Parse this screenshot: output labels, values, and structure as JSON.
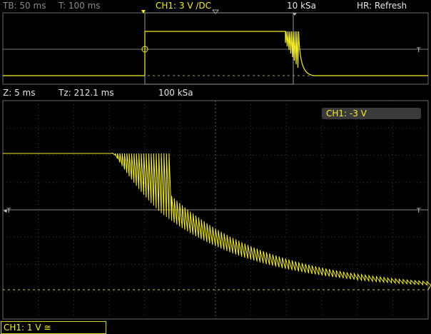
{
  "top_bar": {
    "timebase": "TB: 50 ms",
    "time": "T: 100 ms",
    "channel": "CH1: 3 V ∕DC",
    "sample_rate": "10 kSa",
    "mode": "HR: Refresh"
  },
  "zoom_bar": {
    "zoom": "Z: 5 ms",
    "tz": "Tz: 212.1 ms",
    "sample_rate": "100 kSa"
  },
  "channel_readout": "CH1: -3 V",
  "channel_scale": "CH1: 1 V ≅",
  "trigger_marker": "T",
  "colors": {
    "trace": "#f5ee2a",
    "grid": "#5a5a5a",
    "background": "#000000"
  }
}
